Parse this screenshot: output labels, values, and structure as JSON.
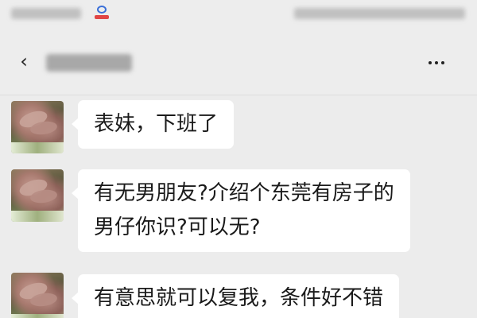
{
  "header": {
    "back_icon": "chevron-left-icon",
    "back_glyph": "‹",
    "more_icon": "more-dots-icon"
  },
  "status_bar": {
    "app_icon": "app-notification-icon"
  },
  "messages": [
    {
      "lines": [
        "表妹，下班了"
      ]
    },
    {
      "lines": [
        "有无男朋友?介绍个东莞有房子的",
        "男仔你识?可以无?"
      ]
    },
    {
      "lines": [
        "有意思就可以复我，条件好不错"
      ]
    }
  ],
  "colors": {
    "background": "#ececec",
    "bubble": "#ffffff",
    "text": "#1a1a1a"
  }
}
